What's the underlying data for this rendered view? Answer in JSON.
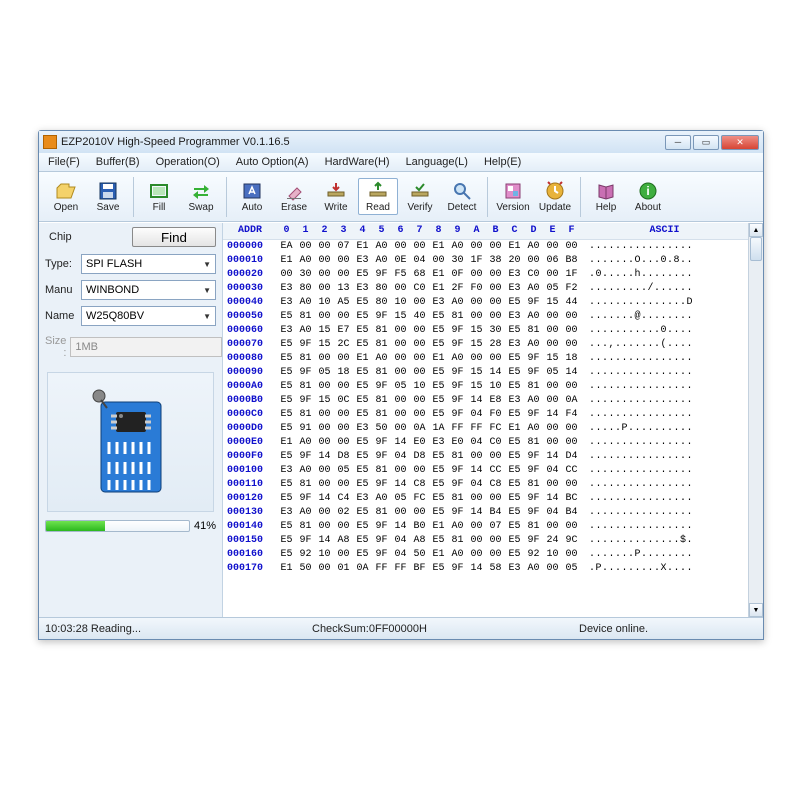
{
  "window": {
    "title": "EZP2010V High-Speed Programmer  V0.1.16.5"
  },
  "menu": {
    "items": [
      "File(F)",
      "Buffer(B)",
      "Operation(O)",
      "Auto Option(A)",
      "HardWare(H)",
      "Language(L)",
      "Help(E)"
    ]
  },
  "toolbar": {
    "open": "Open",
    "save": "Save",
    "fill": "Fill",
    "swap": "Swap",
    "auto": "Auto",
    "erase": "Erase",
    "write": "Write",
    "read": "Read",
    "verify": "Verify",
    "detect": "Detect",
    "version": "Version",
    "update": "Update",
    "help": "Help",
    "about": "About"
  },
  "chip": {
    "group_label": "Chip",
    "find_label": "Find",
    "type_label": "Type:",
    "type_value": "SPI FLASH",
    "manu_label": "Manu",
    "manu_value": "WINBOND",
    "name_label": "Name",
    "name_value": "W25Q80BV",
    "size_label": "Size :",
    "size_value": "1MB"
  },
  "progress": {
    "percent_text": "41%",
    "percent_value": 41
  },
  "hex": {
    "addr_header": "ADDR",
    "byte_headers": [
      "0",
      "1",
      "2",
      "3",
      "4",
      "5",
      "6",
      "7",
      "8",
      "9",
      "A",
      "B",
      "C",
      "D",
      "E",
      "F"
    ],
    "ascii_header": "ASCII",
    "rows": [
      {
        "addr": "000000",
        "bytes": [
          "EA",
          "00",
          "00",
          "07",
          "E1",
          "A0",
          "00",
          "00",
          "E1",
          "A0",
          "00",
          "00",
          "E1",
          "A0",
          "00",
          "00"
        ],
        "ascii": "................"
      },
      {
        "addr": "000010",
        "bytes": [
          "E1",
          "A0",
          "00",
          "00",
          "E3",
          "A0",
          "0E",
          "04",
          "00",
          "30",
          "1F",
          "38",
          "20",
          "00",
          "06",
          "B8"
        ],
        "ascii": ".......O...0.8.."
      },
      {
        "addr": "000020",
        "bytes": [
          "00",
          "30",
          "00",
          "00",
          "E5",
          "9F",
          "F5",
          "68",
          "E1",
          "0F",
          "00",
          "00",
          "E3",
          "C0",
          "00",
          "1F"
        ],
        "ascii": ".0.....h........"
      },
      {
        "addr": "000030",
        "bytes": [
          "E3",
          "80",
          "00",
          "13",
          "E3",
          "80",
          "00",
          "C0",
          "E1",
          "2F",
          "F0",
          "00",
          "E3",
          "A0",
          "05",
          "F2"
        ],
        "ascii": "........./......"
      },
      {
        "addr": "000040",
        "bytes": [
          "E3",
          "A0",
          "10",
          "A5",
          "E5",
          "80",
          "10",
          "00",
          "E3",
          "A0",
          "00",
          "00",
          "E5",
          "9F",
          "15",
          "44"
        ],
        "ascii": "...............D"
      },
      {
        "addr": "000050",
        "bytes": [
          "E5",
          "81",
          "00",
          "00",
          "E5",
          "9F",
          "15",
          "40",
          "E5",
          "81",
          "00",
          "00",
          "E3",
          "A0",
          "00",
          "00"
        ],
        "ascii": ".......@........"
      },
      {
        "addr": "000060",
        "bytes": [
          "E3",
          "A0",
          "15",
          "E7",
          "E5",
          "81",
          "00",
          "00",
          "E5",
          "9F",
          "15",
          "30",
          "E5",
          "81",
          "00",
          "00"
        ],
        "ascii": "...........0...."
      },
      {
        "addr": "000070",
        "bytes": [
          "E5",
          "9F",
          "15",
          "2C",
          "E5",
          "81",
          "00",
          "00",
          "E5",
          "9F",
          "15",
          "28",
          "E3",
          "A0",
          "00",
          "00"
        ],
        "ascii": "...,.......(...."
      },
      {
        "addr": "000080",
        "bytes": [
          "E5",
          "81",
          "00",
          "00",
          "E1",
          "A0",
          "00",
          "00",
          "E1",
          "A0",
          "00",
          "00",
          "E5",
          "9F",
          "15",
          "18"
        ],
        "ascii": "................"
      },
      {
        "addr": "000090",
        "bytes": [
          "E5",
          "9F",
          "05",
          "18",
          "E5",
          "81",
          "00",
          "00",
          "E5",
          "9F",
          "15",
          "14",
          "E5",
          "9F",
          "05",
          "14"
        ],
        "ascii": "................"
      },
      {
        "addr": "0000A0",
        "bytes": [
          "E5",
          "81",
          "00",
          "00",
          "E5",
          "9F",
          "05",
          "10",
          "E5",
          "9F",
          "15",
          "10",
          "E5",
          "81",
          "00",
          "00"
        ],
        "ascii": "................"
      },
      {
        "addr": "0000B0",
        "bytes": [
          "E5",
          "9F",
          "15",
          "0C",
          "E5",
          "81",
          "00",
          "00",
          "E5",
          "9F",
          "14",
          "E8",
          "E3",
          "A0",
          "00",
          "0A"
        ],
        "ascii": "................"
      },
      {
        "addr": "0000C0",
        "bytes": [
          "E5",
          "81",
          "00",
          "00",
          "E5",
          "81",
          "00",
          "00",
          "E5",
          "9F",
          "04",
          "F0",
          "E5",
          "9F",
          "14",
          "F4"
        ],
        "ascii": "................"
      },
      {
        "addr": "0000D0",
        "bytes": [
          "E5",
          "91",
          "00",
          "00",
          "E3",
          "50",
          "00",
          "0A",
          "1A",
          "FF",
          "FF",
          "FC",
          "E1",
          "A0",
          "00",
          "00"
        ],
        "ascii": ".....P.........."
      },
      {
        "addr": "0000E0",
        "bytes": [
          "E1",
          "A0",
          "00",
          "00",
          "E5",
          "9F",
          "14",
          "E0",
          "E3",
          "E0",
          "04",
          "C0",
          "E5",
          "81",
          "00",
          "00"
        ],
        "ascii": "................"
      },
      {
        "addr": "0000F0",
        "bytes": [
          "E5",
          "9F",
          "14",
          "D8",
          "E5",
          "9F",
          "04",
          "D8",
          "E5",
          "81",
          "00",
          "00",
          "E5",
          "9F",
          "14",
          "D4"
        ],
        "ascii": "................"
      },
      {
        "addr": "000100",
        "bytes": [
          "E3",
          "A0",
          "00",
          "05",
          "E5",
          "81",
          "00",
          "00",
          "E5",
          "9F",
          "14",
          "CC",
          "E5",
          "9F",
          "04",
          "CC"
        ],
        "ascii": "................"
      },
      {
        "addr": "000110",
        "bytes": [
          "E5",
          "81",
          "00",
          "00",
          "E5",
          "9F",
          "14",
          "C8",
          "E5",
          "9F",
          "04",
          "C8",
          "E5",
          "81",
          "00",
          "00"
        ],
        "ascii": "................"
      },
      {
        "addr": "000120",
        "bytes": [
          "E5",
          "9F",
          "14",
          "C4",
          "E3",
          "A0",
          "05",
          "FC",
          "E5",
          "81",
          "00",
          "00",
          "E5",
          "9F",
          "14",
          "BC"
        ],
        "ascii": "................"
      },
      {
        "addr": "000130",
        "bytes": [
          "E3",
          "A0",
          "00",
          "02",
          "E5",
          "81",
          "00",
          "00",
          "E5",
          "9F",
          "14",
          "B4",
          "E5",
          "9F",
          "04",
          "B4"
        ],
        "ascii": "................"
      },
      {
        "addr": "000140",
        "bytes": [
          "E5",
          "81",
          "00",
          "00",
          "E5",
          "9F",
          "14",
          "B0",
          "E1",
          "A0",
          "00",
          "07",
          "E5",
          "81",
          "00",
          "00"
        ],
        "ascii": "................"
      },
      {
        "addr": "000150",
        "bytes": [
          "E5",
          "9F",
          "14",
          "A8",
          "E5",
          "9F",
          "04",
          "A8",
          "E5",
          "81",
          "00",
          "00",
          "E5",
          "9F",
          "24",
          "9C"
        ],
        "ascii": "..............$."
      },
      {
        "addr": "000160",
        "bytes": [
          "E5",
          "92",
          "10",
          "00",
          "E5",
          "9F",
          "04",
          "50",
          "E1",
          "A0",
          "00",
          "00",
          "E5",
          "92",
          "10",
          "00"
        ],
        "ascii": ".......P........"
      },
      {
        "addr": "000170",
        "bytes": [
          "E1",
          "50",
          "00",
          "01",
          "0A",
          "FF",
          "FF",
          "BF",
          "E5",
          "9F",
          "14",
          "58",
          "E3",
          "A0",
          "00",
          "05"
        ],
        "ascii": ".P.........X...."
      }
    ]
  },
  "status": {
    "left": "10:03:28 Reading...",
    "mid": "CheckSum:0FF00000H",
    "right": "Device online."
  }
}
